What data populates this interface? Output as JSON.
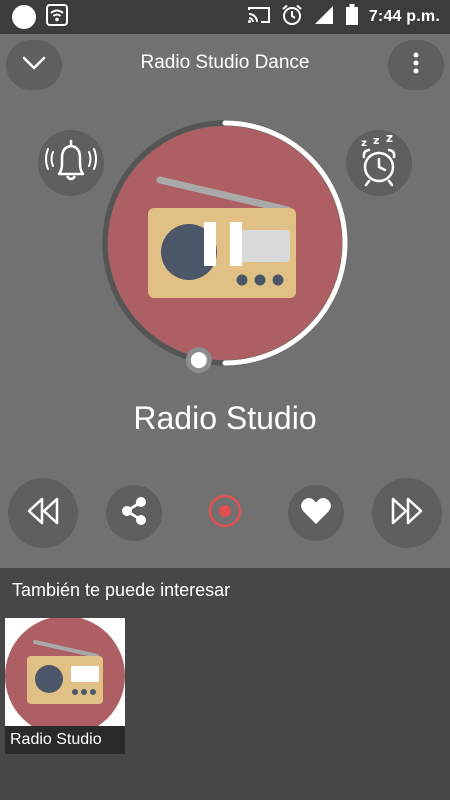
{
  "status_bar": {
    "time": "7:44 p.m.",
    "icons": [
      "notification-dot-icon",
      "wifi-icon",
      "cast-icon",
      "alarm-clock-icon",
      "signal-icon",
      "battery-icon"
    ]
  },
  "header": {
    "title": "Radio Studio Dance",
    "collapse_icon": "chevron-down-icon",
    "menu_icon": "more-vertical-icon"
  },
  "player": {
    "station_name": "Radio Studio",
    "playback_state": "playing",
    "center_icon": "pause-icon",
    "progress": 0.5,
    "alarm_icon": "bell-icon",
    "sleep_icon": "sleep-timer-icon"
  },
  "controls": [
    {
      "name": "rewind",
      "icon": "rewind-icon"
    },
    {
      "name": "share",
      "icon": "share-icon"
    },
    {
      "name": "record",
      "icon": "record-icon"
    },
    {
      "name": "favorite",
      "icon": "heart-icon"
    },
    {
      "name": "forward",
      "icon": "fast-forward-icon"
    }
  ],
  "recommendations": {
    "title": "También te puede interesar",
    "items": [
      {
        "label": "Radio Studio"
      }
    ]
  },
  "colors": {
    "player_background": "#717171",
    "bottom_background": "#474747",
    "artwork_circle": "#ad5f63",
    "radio_body": "#e0c084",
    "record_accent": "#e14f4f",
    "progress_ring": "#ffffff"
  }
}
